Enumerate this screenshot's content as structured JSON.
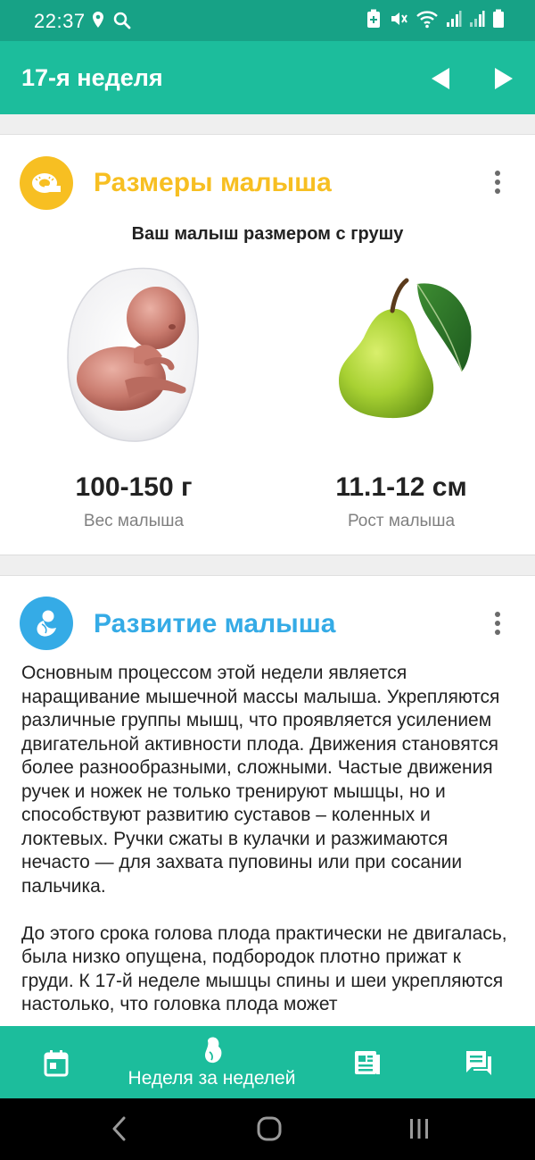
{
  "status_bar": {
    "time": "22:37",
    "icons": [
      "location-icon",
      "search-icon",
      "battery-saver-icon",
      "mute-icon",
      "wifi-icon",
      "signal-icon",
      "signal-icon-2",
      "battery-icon"
    ]
  },
  "app_bar": {
    "title": "17-я неделя",
    "prev_icon": "arrow-left-icon",
    "next_icon": "arrow-right-icon"
  },
  "size_card": {
    "title": "Размеры малыша",
    "title_color": "#f7bf22",
    "icon": "tape-measure-icon",
    "subtitle": "Ваш малыш размером с грушу",
    "weight_value": "100-150 г",
    "weight_label": "Вес малыша",
    "height_value": "11.1-12 см",
    "height_label": "Рост малыша"
  },
  "development_card": {
    "title": "Развитие малыша",
    "title_color": "#35abe6",
    "icon": "fetus-icon",
    "paragraphs": [
      "Основным процессом этой недели является наращивание мышечной массы малыша. Укрепляются различные группы мышц, что проявляется усилением двигательной активности плода. Движения становятся более разнообразными, сложными. Частые движения ручек и ножек не только тренируют мышцы, но и способствуют развитию суставов – коленных и локтевых. Ручки сжаты в кулачки и разжимаются нечасто — для захвата пуповины или при сосании пальчика.",
      "До этого срока голова плода практически не двигалась, была низко опущена, подбородок плотно прижат к груди. К 17-й неделе мышцы спины и шеи укрепляются настолько, что головка плода может"
    ]
  },
  "bottom_nav": {
    "items": [
      {
        "icon": "calendar-icon",
        "label": ""
      },
      {
        "icon": "baby-icon",
        "label": "Неделя за неделей"
      },
      {
        "icon": "articles-icon",
        "label": ""
      },
      {
        "icon": "chat-icon",
        "label": ""
      }
    ]
  },
  "colors": {
    "status_bar": "#17a286",
    "primary": "#1cbd9c",
    "size_accent": "#f7bf22",
    "development_accent": "#35abe6"
  }
}
